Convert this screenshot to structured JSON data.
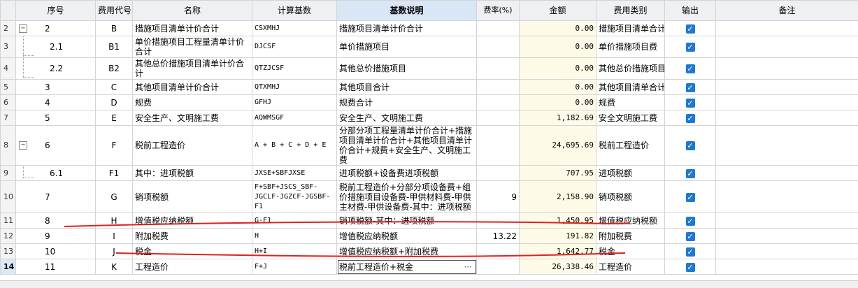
{
  "headers": {
    "rownum": "",
    "seq": "序号",
    "code": "费用代号",
    "name": "名称",
    "base": "计算基数",
    "base_desc": "基数说明",
    "rate": "费率(%)",
    "amount": "金额",
    "category": "费用类别",
    "output": "输出",
    "remark": "备注"
  },
  "rows": [
    {
      "rownum": "2",
      "seq": "2",
      "tree": "minus",
      "code": "B",
      "name": "措施项目清单计价合计",
      "base": "CSXMHJ",
      "desc": "措施项目清单计价合计",
      "rate": "",
      "amount": "0.00",
      "category": "措施项目清单合计",
      "output": "✓"
    },
    {
      "rownum": "3",
      "seq": "2.1",
      "tree": "child",
      "code": "B1",
      "name": "单价措施项目工程量清单计价合计",
      "base": "DJCSF",
      "desc": "单价措施项目",
      "rate": "",
      "amount": "0.00",
      "category": "单价措施项目费",
      "output": "✓"
    },
    {
      "rownum": "4",
      "seq": "2.2",
      "tree": "last",
      "code": "B2",
      "name": "其他总价措施项目清单计价合计",
      "base": "QTZJCSF",
      "desc": "其他总价措施项目",
      "rate": "",
      "amount": "0.00",
      "category": "其他总价措施项目费",
      "output": "✓"
    },
    {
      "rownum": "5",
      "seq": "3",
      "tree": "",
      "code": "C",
      "name": "其他项目清单计价合计",
      "base": "QTXMHJ",
      "desc": "其他项目合计",
      "rate": "",
      "amount": "0.00",
      "category": "其他项目清单合计",
      "output": "✓"
    },
    {
      "rownum": "6",
      "seq": "4",
      "tree": "",
      "code": "D",
      "name": "规费",
      "base": "GFHJ",
      "desc": "规费合计",
      "rate": "",
      "amount": "0.00",
      "category": "规费",
      "output": "✓"
    },
    {
      "rownum": "7",
      "seq": "5",
      "tree": "",
      "code": "E",
      "name": "安全生产、文明施工费",
      "base": "AQWMSGF",
      "desc": "安全生产、文明施工费",
      "rate": "",
      "amount": "1,182.69",
      "category": "安全文明施工费",
      "output": "✓"
    },
    {
      "rownum": "8",
      "seq": "6",
      "tree": "minus",
      "code": "F",
      "name": "税前工程造价",
      "base": "A + B + C + D + E",
      "desc": "分部分项工程量清单计价合计+措施项目清单计价合计+其他项目清单计价合计+规费+安全生产、文明施工费",
      "rate": "",
      "amount": "24,695.69",
      "category": "税前工程造价",
      "output": "✓"
    },
    {
      "rownum": "9",
      "seq": "6.1",
      "tree": "last",
      "code": "F1",
      "name": "其中：进项税额",
      "base": "JXSE+SBFJXSE",
      "desc": "进项税额+设备费进项税额",
      "rate": "",
      "amount": "707.95",
      "category": "进项税额",
      "output": "✓"
    },
    {
      "rownum": "10",
      "seq": "7",
      "tree": "",
      "code": "G",
      "name": "销项税额",
      "base": "F+SBF+JSCS_SBF-JGCLF-JGZCF-JGSBF-F1",
      "desc": "税前工程造价+分部分项设备费+组价措施项目设备费-甲供材料费-甲供主材费-甲供设备费-其中：进项税额",
      "rate": "9",
      "amount": "2,158.90",
      "category": "销项税额",
      "output": "✓"
    },
    {
      "rownum": "11",
      "seq": "8",
      "tree": "",
      "code": "H",
      "name": "增值税应纳税额",
      "base": "G-F1",
      "desc": "销项税额-其中：进项税额",
      "rate": "",
      "amount": "1,450.95",
      "category": "增值税应纳税额",
      "output": "✓"
    },
    {
      "rownum": "12",
      "seq": "9",
      "tree": "",
      "code": "I",
      "name": "附加税费",
      "base": "H",
      "desc": "增值税应纳税额",
      "rate": "13.22",
      "amount": "191.82",
      "category": "附加税费",
      "output": "✓"
    },
    {
      "rownum": "13",
      "seq": "10",
      "tree": "",
      "code": "J",
      "name": "税金",
      "base": "H+I",
      "desc": "增值税应纳税额+附加税费",
      "rate": "",
      "amount": "1,642.77",
      "category": "税金",
      "output": "✓"
    },
    {
      "rownum": "14",
      "seq": "11",
      "tree": "",
      "code": "K",
      "name": "工程造价",
      "base": "F+J",
      "desc": "税前工程造价+税金",
      "desc_more": "···",
      "rate": "",
      "amount": "26,338.46",
      "category": "工程造价",
      "output": "✓"
    }
  ],
  "colors": {
    "check": "#1f78d1",
    "annotation": "#e02020",
    "amount_bg": "#fdfbe7"
  }
}
